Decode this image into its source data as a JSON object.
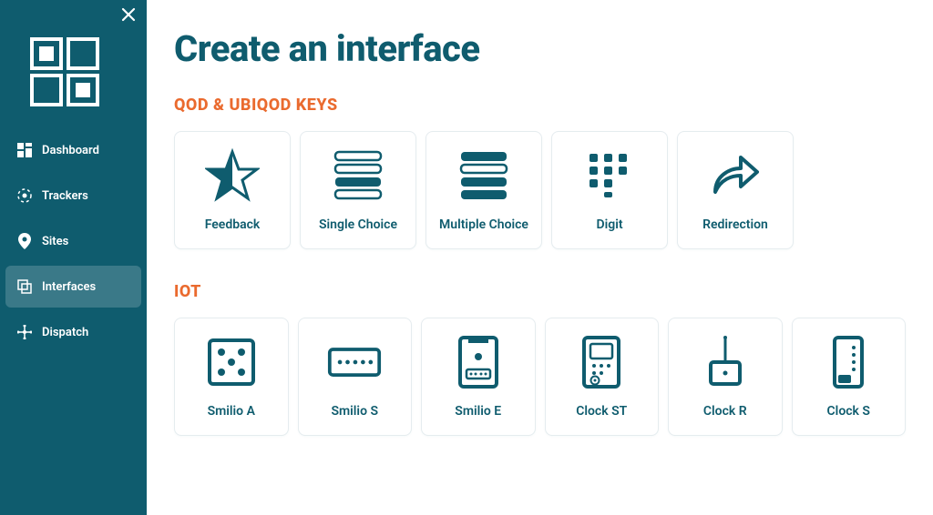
{
  "colors": {
    "brand": "#0f5c6e",
    "accent": "#ea6a2e"
  },
  "sidebar": {
    "items": [
      {
        "label": "Dashboard"
      },
      {
        "label": "Trackers"
      },
      {
        "label": "Sites"
      },
      {
        "label": "Interfaces"
      },
      {
        "label": "Dispatch"
      }
    ]
  },
  "page": {
    "title": "Create an interface"
  },
  "sections": {
    "keys": {
      "title": "QOD & UBIQOD KEYS",
      "cards": [
        {
          "label": "Feedback"
        },
        {
          "label": "Single Choice"
        },
        {
          "label": "Multiple Choice"
        },
        {
          "label": "Digit"
        },
        {
          "label": "Redirection"
        }
      ]
    },
    "iot": {
      "title": "IOT",
      "cards": [
        {
          "label": "Smilio A"
        },
        {
          "label": "Smilio S"
        },
        {
          "label": "Smilio E"
        },
        {
          "label": "Clock ST"
        },
        {
          "label": "Clock R"
        },
        {
          "label": "Clock S"
        }
      ]
    }
  }
}
